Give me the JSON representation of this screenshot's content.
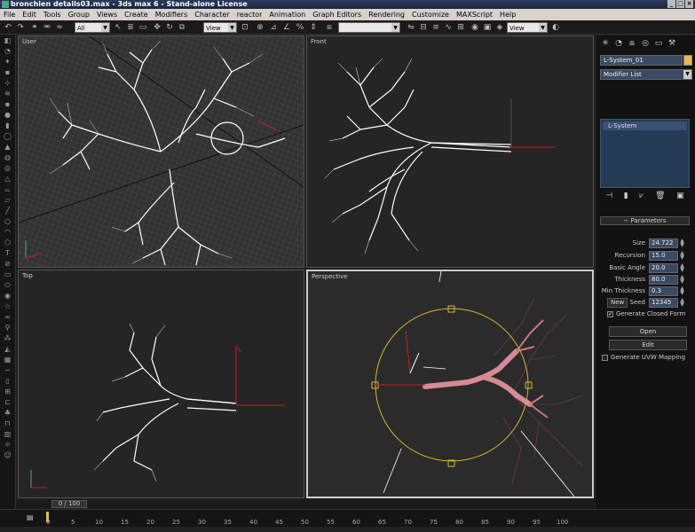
{
  "window": {
    "title": "bronchien details03.max - 3ds max 6 - Stand-alone License",
    "controls": [
      "_",
      "□",
      "×"
    ]
  },
  "menu": [
    "File",
    "Edit",
    "Tools",
    "Group",
    "Views",
    "Create",
    "Modifiers",
    "Character",
    "reactor",
    "Animation",
    "Graph Editors",
    "Rendering",
    "Customize",
    "MAXScript",
    "Help"
  ],
  "toolbar": {
    "selection_filter": "All",
    "ref_coord_1": "View",
    "named_selection": "",
    "ref_coord_2": "View"
  },
  "viewports": {
    "top_left": "User",
    "top_right": "Front",
    "bottom_left": "Top",
    "bottom_right": "Perspective"
  },
  "command_panel": {
    "object_name": "L-System_01",
    "modifier_list": "Modifier List",
    "stack_item": "L-System",
    "rollout_title": "Parameters",
    "params": [
      {
        "label": "Size",
        "value": "24.722"
      },
      {
        "label": "Recursion",
        "value": "15.0"
      },
      {
        "label": "Basic Angle",
        "value": "20.0"
      },
      {
        "label": "Thickness",
        "value": "80.0"
      },
      {
        "label": "Min Thickness",
        "value": "0.3"
      }
    ],
    "new_label": "New",
    "seed_label": "Seed",
    "seed_value": "12345",
    "closed_form_label": "Generate Closed Form",
    "open_label": "Open",
    "edit_label": "Edit",
    "uvw_label": "Generate UVW Mapping"
  },
  "time": {
    "slider": "0 / 100",
    "ticks": [
      "0",
      "5",
      "10",
      "15",
      "20",
      "25",
      "30",
      "35",
      "40",
      "45",
      "50",
      "55",
      "60",
      "65",
      "70",
      "75",
      "80",
      "85",
      "90",
      "95",
      "100"
    ]
  },
  "colors": {
    "accent": "#e8b84a",
    "axis_red": "#c0202a",
    "selection": "#d4b830",
    "tree_pink": "#d68a96"
  }
}
